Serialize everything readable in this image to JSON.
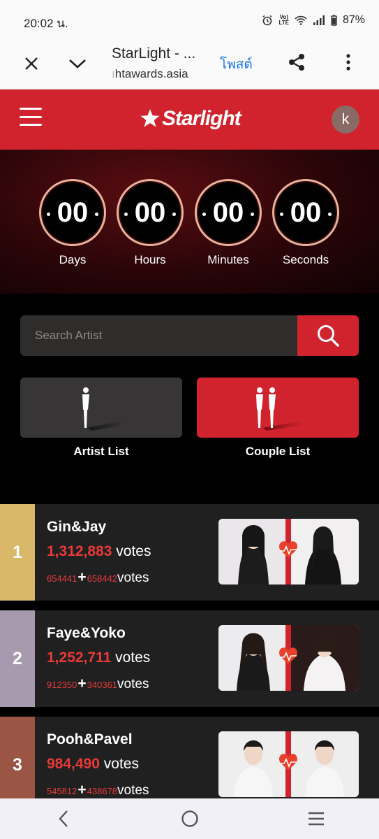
{
  "status": {
    "time": "20:02 น.",
    "battery": "87%",
    "network": "VoLTE"
  },
  "browser": {
    "title": "StarLight - ...",
    "url_faded": "ı",
    "url": "htawards.asia",
    "post_label": "โพสต์"
  },
  "header": {
    "logo_text": "Starlight",
    "avatar_letter": "k",
    "colors": {
      "brand_red": "#d0232d",
      "dark": "#000000"
    }
  },
  "countdown": [
    {
      "value": "00",
      "label": "Days"
    },
    {
      "value": "00",
      "label": "Hours"
    },
    {
      "value": "00",
      "label": "Minutes"
    },
    {
      "value": "00",
      "label": "Seconds"
    }
  ],
  "search": {
    "placeholder": "Search Artist",
    "icon": "search-icon"
  },
  "lists": {
    "artist_label": "Artist List",
    "couple_label": "Couple List"
  },
  "rankings": [
    {
      "rank": "1",
      "name": "Gin&Jay",
      "votes": "1,312,883",
      "votes_word": "votes",
      "split_a": "654441",
      "split_b": "658442",
      "split_word": "votes",
      "rank_color": "#d9b86a"
    },
    {
      "rank": "2",
      "name": "Faye&Yoko",
      "votes": "1,252,711",
      "votes_word": "votes",
      "split_a": "912350",
      "split_b": "340361",
      "split_word": "votes",
      "rank_color": "#a79aae"
    },
    {
      "rank": "3",
      "name": "Pooh&Pavel",
      "votes": "984,490",
      "votes_word": "votes",
      "split_a": "545812",
      "split_b": "438678",
      "split_word": "votes",
      "rank_color": "#9a5545"
    }
  ],
  "nav": {
    "back_icon": "back-icon",
    "home_icon": "home-icon",
    "recents_icon": "recents-icon"
  }
}
